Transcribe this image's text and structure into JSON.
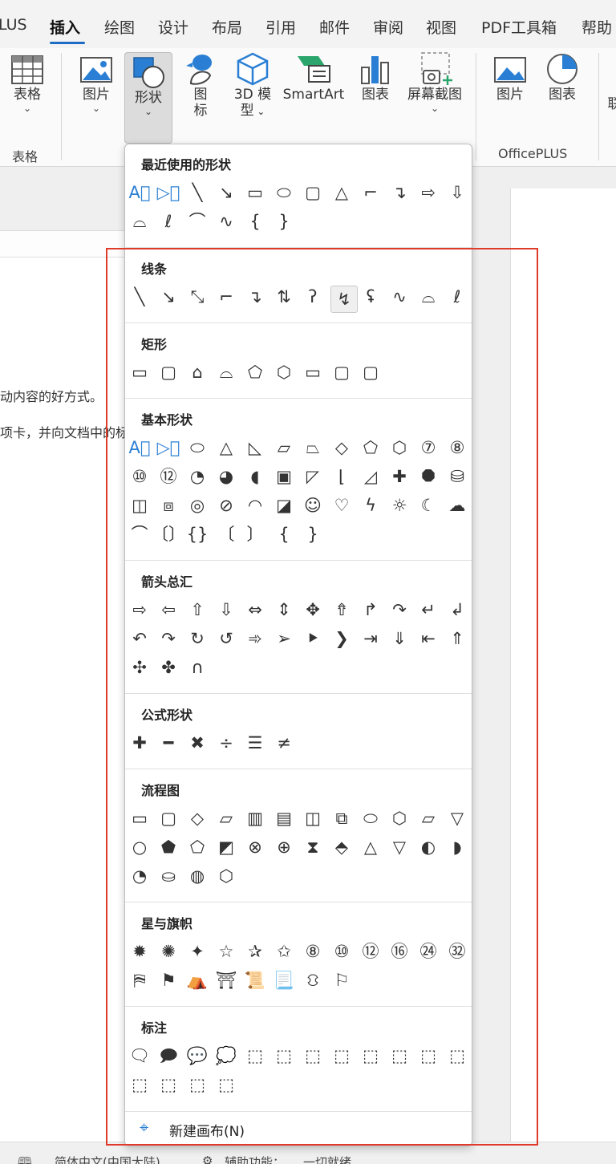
{
  "menu": {
    "items": [
      "LUS",
      "插入",
      "绘图",
      "设计",
      "布局",
      "引用",
      "邮件",
      "审阅",
      "视图",
      "PDF工具箱",
      "帮助"
    ],
    "active": "插入"
  },
  "ribbon": {
    "table_label": "表格",
    "picture_label": "图片",
    "shapes_label": "形状",
    "icons_label_1": "图",
    "icons_label_2": "标",
    "model_label_1": "3D 模",
    "model_label_2": "型",
    "smartart_label": "SmartArt",
    "chart_label": "图表",
    "screenshot_label": "屏幕截图",
    "op_picture_label": "图片",
    "op_chart_label": "图表",
    "cut_label": "联",
    "group_table": "表格",
    "group_officeplus": "OfficePLUS",
    "accent": "#1f6cc5"
  },
  "doc": {
    "line1": "动内容的好方式。",
    "line2": "项卡，并向文档中的标"
  },
  "status": {
    "language": "简体中文(中国大陆)",
    "accessibility": "辅助功能：",
    "ready": "一切就绪"
  },
  "panel": {
    "sections": [
      {
        "title": "最近使用的形状",
        "rows": [
          [
            "A⃞",
            "▷⃞",
            "╲",
            "↘",
            "▭",
            "⬭",
            "▢",
            "△",
            "⌐",
            "↴",
            "⇨",
            "⇩"
          ],
          [
            "⌓",
            "ℓ",
            "⌒",
            "∿",
            "{",
            "}"
          ]
        ]
      },
      {
        "title": "线条",
        "rows": [
          [
            "╲",
            "↘",
            "⤡",
            "⌐",
            "↴",
            "⇅",
            "ʔ",
            "↯",
            "ʢ",
            "∿",
            "⌓",
            "ℓ"
          ]
        ]
      },
      {
        "title": "矩形",
        "rows": [
          [
            "▭",
            "▢",
            "⌂",
            "⌓",
            "⬠",
            "⬡",
            "▭",
            "▢",
            "▢"
          ]
        ]
      },
      {
        "title": "基本形状",
        "rows": [
          [
            "A⃞",
            "▷⃞",
            "⬭",
            "△",
            "◺",
            "▱",
            "⏢",
            "◇",
            "⬠",
            "⬡",
            "⑦",
            "⑧"
          ],
          [
            "⑩",
            "⑫",
            "◔",
            "◕",
            "◖",
            "▣",
            "◸",
            "⌊",
            "◿",
            "✚",
            "⯃",
            "⛁"
          ],
          [
            "◫",
            "⧈",
            "◎",
            "⊘",
            "◠",
            "◪",
            "☺",
            "♡",
            "ϟ",
            "☼",
            "☾",
            "☁"
          ],
          [
            "⌒",
            "〔〕",
            "{}",
            "〔",
            "〕",
            "{",
            "}"
          ]
        ]
      },
      {
        "title": "箭头总汇",
        "rows": [
          [
            "⇨",
            "⇦",
            "⇧",
            "⇩",
            "⇔",
            "⇕",
            "✥",
            "⇮",
            "↱",
            "↷",
            "↵",
            "↲"
          ],
          [
            "↶",
            "↷",
            "↻",
            "↺",
            "➾",
            "➢",
            "⯈",
            "❯",
            "⇥",
            "⇓",
            "⇤",
            "⇑"
          ],
          [
            "✣",
            "✤",
            "∩"
          ]
        ]
      },
      {
        "title": "公式形状",
        "rows": [
          [
            "✚",
            "━",
            "✖",
            "÷",
            "☰",
            "≠"
          ]
        ]
      },
      {
        "title": "流程图",
        "rows": [
          [
            "▭",
            "▢",
            "◇",
            "▱",
            "▥",
            "▤",
            "◫",
            "⧉",
            "⬭",
            "⬡",
            "⏥",
            "▽"
          ],
          [
            "○",
            "⬟",
            "⬠",
            "◩",
            "⊗",
            "⊕",
            "⧗",
            "⬘",
            "△",
            "▽",
            "◐",
            "◗"
          ],
          [
            "◔",
            "⛀",
            "◍",
            "⬡"
          ]
        ]
      },
      {
        "title": "星与旗帜",
        "rows": [
          [
            "✹",
            "✺",
            "✦",
            "☆",
            "✰",
            "✩",
            "⑧",
            "⑩",
            "⑫",
            "⑯",
            "㉔",
            "㉜"
          ],
          [
            "⛿",
            "⚑",
            "⛺",
            "⛩",
            "📜",
            "📃",
            "⛻",
            "⚐"
          ]
        ]
      },
      {
        "title": "标注",
        "rows": [
          [
            "🗨",
            "🗩",
            "💬",
            "💭",
            "⬚",
            "⬚",
            "⬚",
            "⬚",
            "⬚",
            "⬚",
            "⬚",
            "⬚"
          ],
          [
            "⬚",
            "⬚",
            "⬚",
            "⬚"
          ]
        ]
      }
    ],
    "new_canvas_label": "新建画布(N)"
  }
}
